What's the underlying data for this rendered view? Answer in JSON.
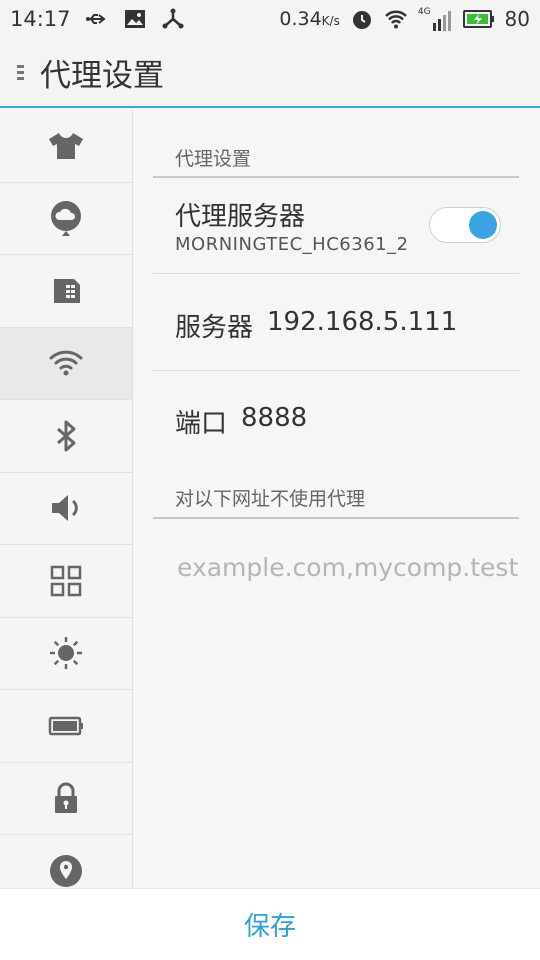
{
  "status_bar": {
    "time": "14:17",
    "speed": "0.34",
    "speed_unit": "K/s",
    "network_label": "4G",
    "battery": "80",
    "icons": [
      "usb-icon",
      "image-icon",
      "share-icon",
      "alarm-icon",
      "wifi-icon",
      "signal-icon",
      "battery-charging-icon"
    ]
  },
  "header": {
    "title": "代理设置"
  },
  "sidebar": {
    "items": [
      {
        "icon": "theme-shirt-icon"
      },
      {
        "icon": "cloud-icon"
      },
      {
        "icon": "sim-card-icon"
      },
      {
        "icon": "wifi-icon",
        "active": true
      },
      {
        "icon": "bluetooth-icon"
      },
      {
        "icon": "volume-icon"
      },
      {
        "icon": "apps-grid-icon"
      },
      {
        "icon": "brightness-icon"
      },
      {
        "icon": "battery-icon"
      },
      {
        "icon": "lock-icon"
      },
      {
        "icon": "location-icon"
      }
    ]
  },
  "content": {
    "section_title": "代理设置",
    "proxy_server": {
      "label": "代理服务器",
      "ssid": "MORNINGTEC_HC6361_2",
      "enabled": true
    },
    "server": {
      "label": "服务器",
      "value": "192.168.5.111"
    },
    "port": {
      "label": "端口",
      "value": "8888"
    },
    "bypass": {
      "label": "对以下网址不使用代理",
      "placeholder": "example.com,mycomp.test"
    }
  },
  "footer": {
    "save_label": "保存"
  },
  "colors": {
    "accent": "#39a9d6",
    "toggle_on": "#3aa3e3",
    "icon_gray": "#6a6a6a"
  }
}
